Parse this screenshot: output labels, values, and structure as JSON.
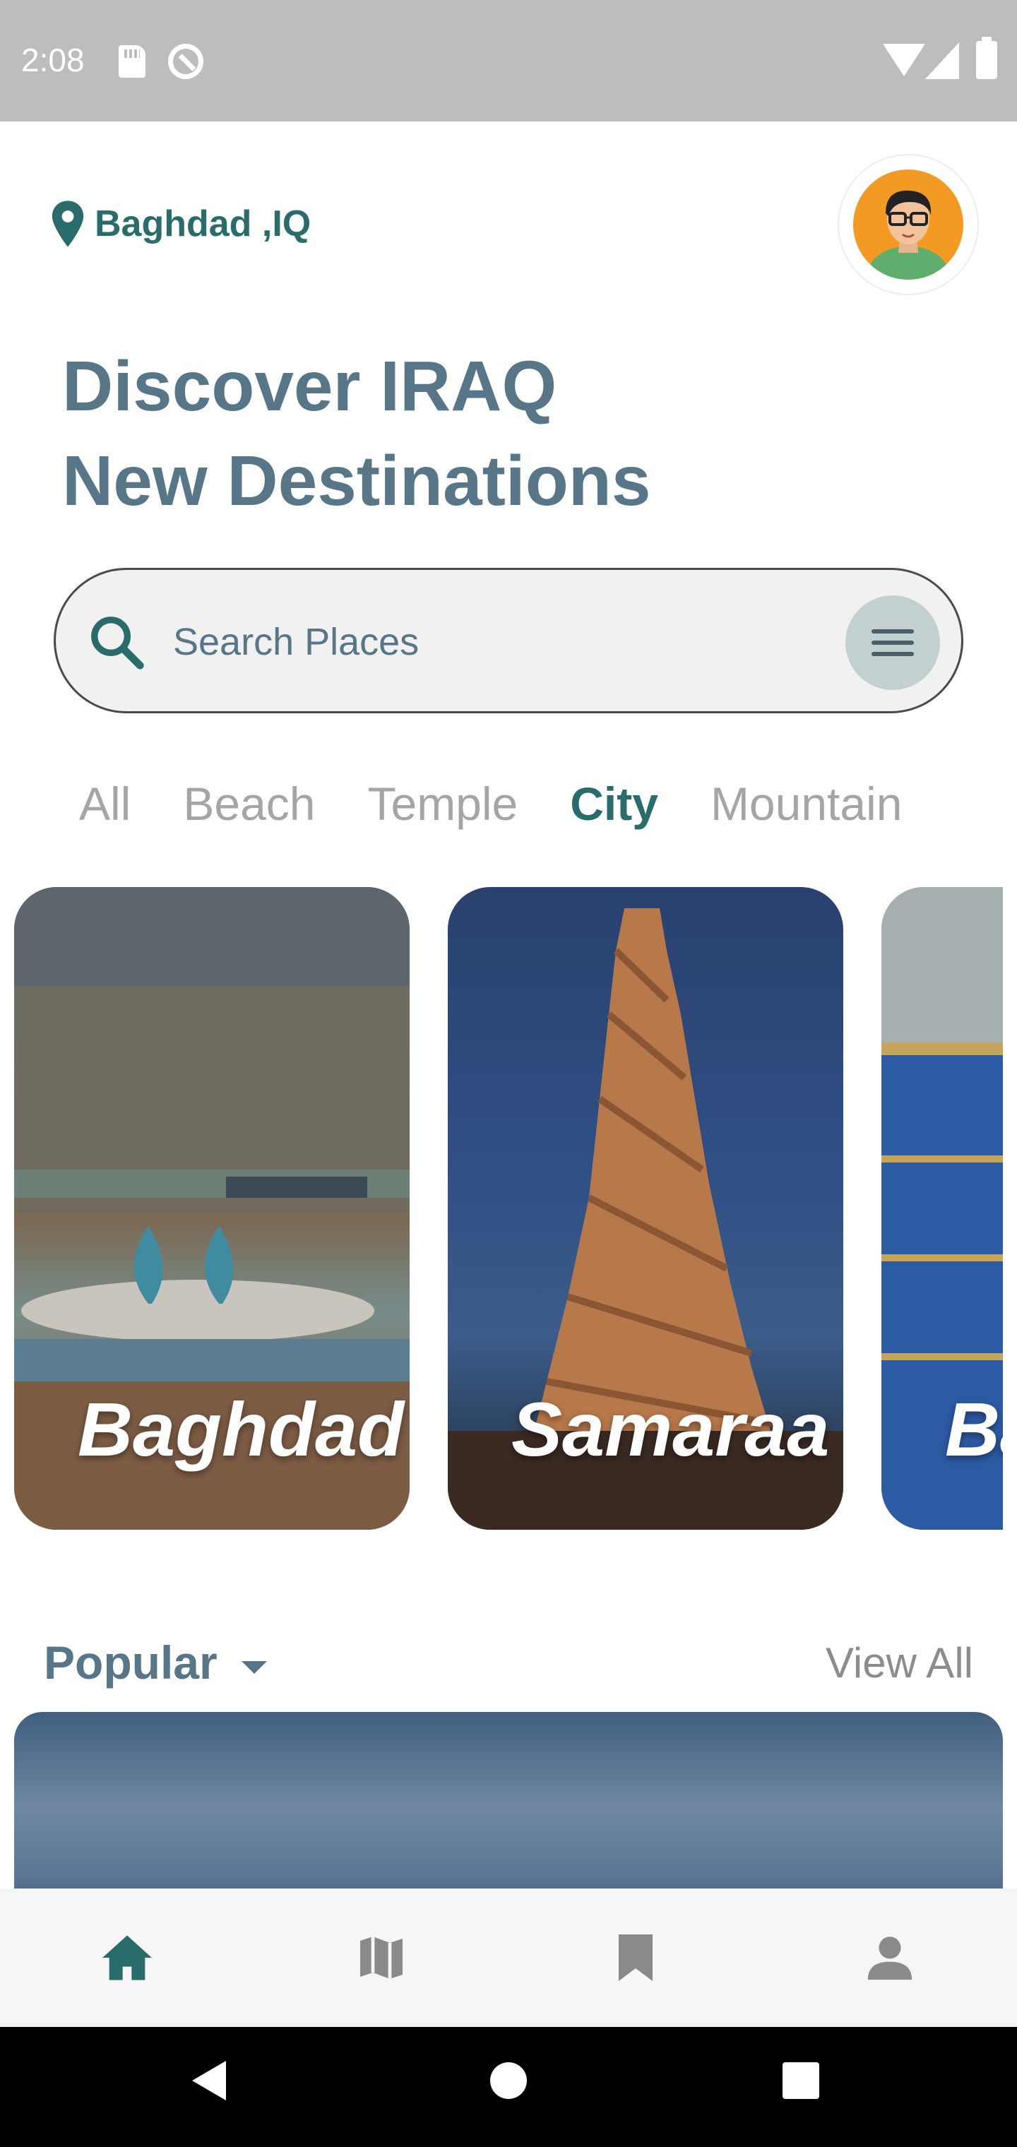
{
  "status_bar": {
    "time": "2:08"
  },
  "header": {
    "location": "Baghdad ,IQ",
    "headline_line1": "Discover IRAQ",
    "headline_line2": "New Destinations"
  },
  "search": {
    "placeholder": "Search Places"
  },
  "categories": [
    {
      "label": "All",
      "active": false
    },
    {
      "label": "Beach",
      "active": false
    },
    {
      "label": "Temple",
      "active": false
    },
    {
      "label": "City",
      "active": true
    },
    {
      "label": "Mountain",
      "active": false
    }
  ],
  "destinations": [
    {
      "title": "Baghdad"
    },
    {
      "title": "Samaraa"
    },
    {
      "title": "Babylon"
    }
  ],
  "popular": {
    "label": "Popular",
    "view_all": "View All"
  },
  "bottom_nav": [
    {
      "icon": "home-icon",
      "active": true
    },
    {
      "icon": "map-icon",
      "active": false
    },
    {
      "icon": "bookmark-icon",
      "active": false
    },
    {
      "icon": "profile-icon",
      "active": false
    }
  ],
  "colors": {
    "primary": "#2a6b6b",
    "headline": "#577687",
    "inactive": "#a5a5a5",
    "status_bar": "#bdbdbd"
  }
}
